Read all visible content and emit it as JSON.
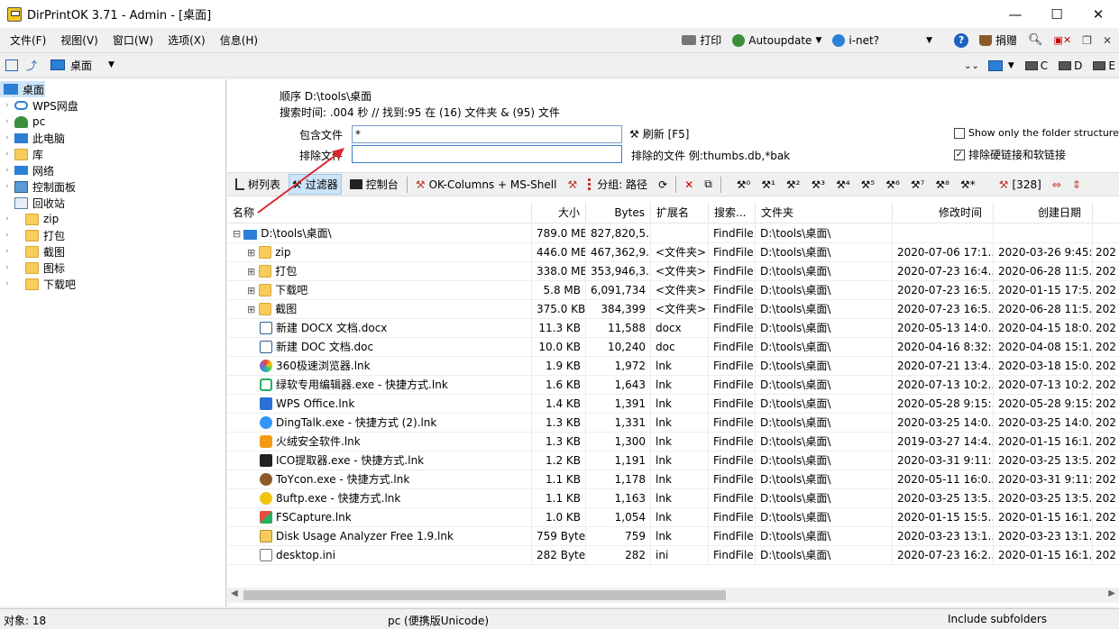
{
  "window": {
    "title": "DirPrintOK 3.71 - Admin - [桌面]",
    "minimize": "—",
    "maximize": "☐",
    "close": "✕"
  },
  "menu": {
    "items": [
      "文件(F)",
      "视图(V)",
      "窗口(W)",
      "选项(X)",
      "信息(H)"
    ],
    "print": "打印",
    "autoupdate": "Autoupdate",
    "inet": "i-net?",
    "donate": "捐赠"
  },
  "location": {
    "current": "桌面",
    "drives": [
      "C",
      "D",
      "E"
    ]
  },
  "tree": {
    "root": "桌面",
    "items": [
      "WPS网盘",
      "pc",
      "此电脑",
      "库",
      "网络",
      "控制面板",
      "回收站",
      "zip",
      "打包",
      "截图",
      "图标",
      "下载吧"
    ]
  },
  "info": {
    "order": "顺序   D:\\tools\\桌面",
    "search_time": "搜索时间: .004 秒 //  找到:95 在 (16) 文件夹 & (95) 文件"
  },
  "filter": {
    "include_label": "包含文件",
    "include_value": "*",
    "refresh": "刷新 [F5]",
    "exclude_label": "排除文件",
    "exclude_value": "",
    "exclude_hint": "排除的文件 例:thumbs.db,*bak",
    "opt_folder_structure": "Show only the folder structure",
    "opt_exclude_links": "排除硬链接和软链接"
  },
  "tabs": {
    "tree": "树列表",
    "filter": "过滤器",
    "console": "控制台",
    "columns": "OK-Columns + MS-Shell",
    "group": "分组: 路径",
    "count": "[328]"
  },
  "columns": [
    "名称",
    "大小",
    "Bytes",
    "扩展名",
    "搜索...",
    "文件夹",
    "修改时间",
    "创建日期"
  ],
  "rows": [
    {
      "name": "D:\\tools\\桌面\\",
      "size": "789.0 MB",
      "bytes": "827,820,5...",
      "ext": "",
      "search": "FindFile",
      "folder": "D:\\tools\\桌面\\",
      "mtime": "",
      "ctime": "",
      "icon": "desktop"
    },
    {
      "name": "zip",
      "size": "446.0 MB",
      "bytes": "467,362,9...",
      "ext": "<文件夹>",
      "search": "FindFile",
      "folder": "D:\\tools\\桌面\\",
      "mtime": "2020-07-06 17:1...",
      "ctime": "2020-03-26 9:45:...",
      "icon": "folder"
    },
    {
      "name": "打包",
      "size": "338.0 MB",
      "bytes": "353,946,3...",
      "ext": "<文件夹>",
      "search": "FindFile",
      "folder": "D:\\tools\\桌面\\",
      "mtime": "2020-07-23 16:4...",
      "ctime": "2020-06-28 11:5...",
      "icon": "folder"
    },
    {
      "name": "下载吧",
      "size": "5.8 MB",
      "bytes": "6,091,734",
      "ext": "<文件夹>",
      "search": "FindFile",
      "folder": "D:\\tools\\桌面\\",
      "mtime": "2020-07-23 16:5...",
      "ctime": "2020-01-15 17:5...",
      "icon": "folder"
    },
    {
      "name": "截图",
      "size": "375.0 KB",
      "bytes": "384,399",
      "ext": "<文件夹>",
      "search": "FindFile",
      "folder": "D:\\tools\\桌面\\",
      "mtime": "2020-07-23 16:5...",
      "ctime": "2020-06-28 11:5...",
      "icon": "folder"
    },
    {
      "name": "新建 DOCX 文档.docx",
      "size": "11.3 KB",
      "bytes": "11,588",
      "ext": "docx",
      "search": "FindFile",
      "folder": "D:\\tools\\桌面\\",
      "mtime": "2020-05-13 14:0...",
      "ctime": "2020-04-15 18:0...",
      "icon": "doc"
    },
    {
      "name": "新建 DOC 文档.doc",
      "size": "10.0 KB",
      "bytes": "10,240",
      "ext": "doc",
      "search": "FindFile",
      "folder": "D:\\tools\\桌面\\",
      "mtime": "2020-04-16 8:32:...",
      "ctime": "2020-04-08 15:1...",
      "icon": "doc"
    },
    {
      "name": "360极速浏览器.lnk",
      "size": "1.9 KB",
      "bytes": "1,972",
      "ext": "lnk",
      "search": "FindFile",
      "folder": "D:\\tools\\桌面\\",
      "mtime": "2020-07-21 13:4...",
      "ctime": "2020-03-18 15:0...",
      "icon": "360"
    },
    {
      "name": "绿软专用编辑器.exe - 快捷方式.lnk",
      "size": "1.6 KB",
      "bytes": "1,643",
      "ext": "lnk",
      "search": "FindFile",
      "folder": "D:\\tools\\桌面\\",
      "mtime": "2020-07-13 10:2...",
      "ctime": "2020-07-13 10:2...",
      "icon": "green"
    },
    {
      "name": "WPS Office.lnk",
      "size": "1.4 KB",
      "bytes": "1,391",
      "ext": "lnk",
      "search": "FindFile",
      "folder": "D:\\tools\\桌面\\",
      "mtime": "2020-05-28 9:15:...",
      "ctime": "2020-05-28 9:15:...",
      "icon": "wps"
    },
    {
      "name": "DingTalk.exe - 快捷方式 (2).lnk",
      "size": "1.3 KB",
      "bytes": "1,331",
      "ext": "lnk",
      "search": "FindFile",
      "folder": "D:\\tools\\桌面\\",
      "mtime": "2020-03-25 14:0...",
      "ctime": "2020-03-25 14:0...",
      "icon": "ding"
    },
    {
      "name": "火绒安全软件.lnk",
      "size": "1.3 KB",
      "bytes": "1,300",
      "ext": "lnk",
      "search": "FindFile",
      "folder": "D:\\tools\\桌面\\",
      "mtime": "2019-03-27 14:4...",
      "ctime": "2020-01-15 16:1...",
      "icon": "huorong"
    },
    {
      "name": "ICO提取器.exe - 快捷方式.lnk",
      "size": "1.2 KB",
      "bytes": "1,191",
      "ext": "lnk",
      "search": "FindFile",
      "folder": "D:\\tools\\桌面\\",
      "mtime": "2020-03-31 9:11:...",
      "ctime": "2020-03-25 13:5...",
      "icon": "ico"
    },
    {
      "name": "ToYcon.exe - 快捷方式.lnk",
      "size": "1.1 KB",
      "bytes": "1,178",
      "ext": "lnk",
      "search": "FindFile",
      "folder": "D:\\tools\\桌面\\",
      "mtime": "2020-05-11 16:0...",
      "ctime": "2020-03-31 9:11:...",
      "icon": "toycon"
    },
    {
      "name": "8uftp.exe - 快捷方式.lnk",
      "size": "1.1 KB",
      "bytes": "1,163",
      "ext": "lnk",
      "search": "FindFile",
      "folder": "D:\\tools\\桌面\\",
      "mtime": "2020-03-25 13:5...",
      "ctime": "2020-03-25 13:5...",
      "icon": "ftp"
    },
    {
      "name": "FSCapture.lnk",
      "size": "1.0 KB",
      "bytes": "1,054",
      "ext": "lnk",
      "search": "FindFile",
      "folder": "D:\\tools\\桌面\\",
      "mtime": "2020-01-15 15:5...",
      "ctime": "2020-01-15 16:1...",
      "icon": "fsc"
    },
    {
      "name": "Disk Usage Analyzer Free 1.9.lnk",
      "size": "759 Byte",
      "bytes": "759",
      "ext": "lnk",
      "search": "FindFile",
      "folder": "D:\\tools\\桌面\\",
      "mtime": "2020-03-23 13:1...",
      "ctime": "2020-03-23 13:1...",
      "icon": "disk"
    },
    {
      "name": "desktop.ini",
      "size": "282 Byte",
      "bytes": "282",
      "ext": "ini",
      "search": "FindFile",
      "folder": "D:\\tools\\桌面\\",
      "mtime": "2020-07-23 16:2...",
      "ctime": "2020-01-15 16:1...",
      "icon": "ini"
    }
  ],
  "status": {
    "objects": "对象: 18",
    "mode": "pc (便携版Unicode)",
    "subfolders": "Include subfolders"
  },
  "colors": {
    "accent": "#2b7fd5",
    "folder": "#f6cc5a",
    "selection": "#cce4f7",
    "arrow": "#d9262c"
  }
}
